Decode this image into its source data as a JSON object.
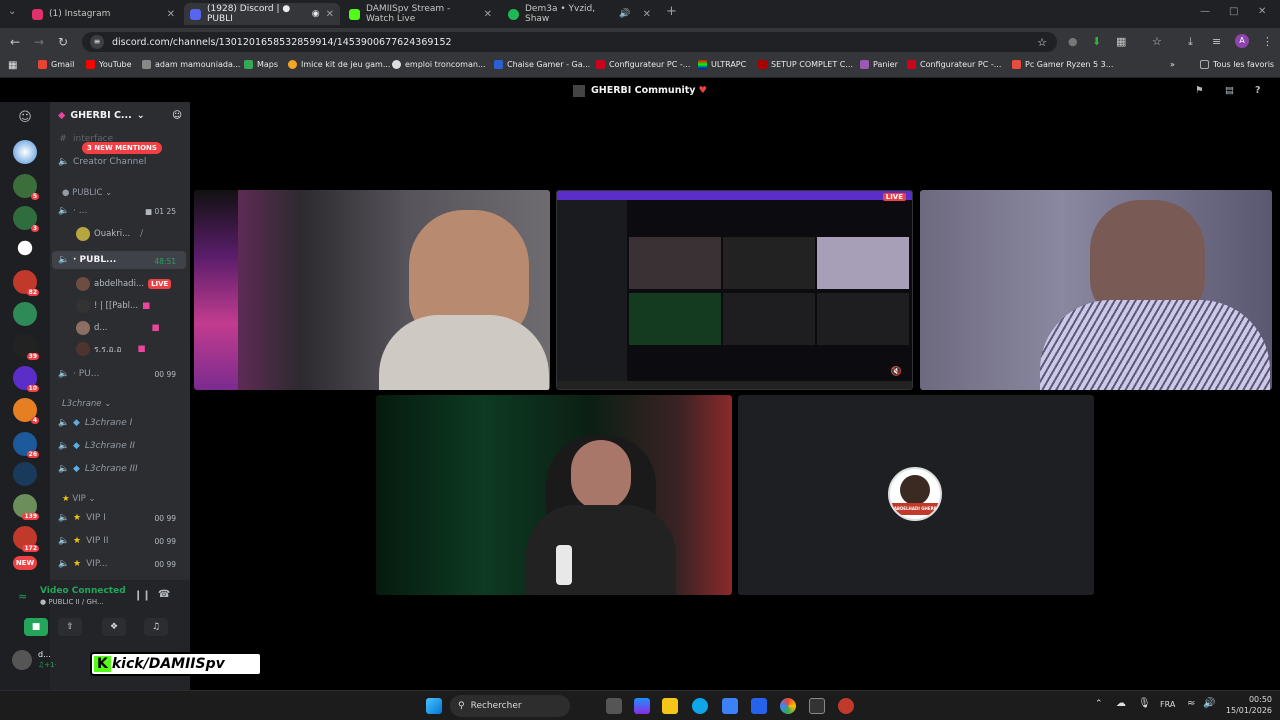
{
  "tabs": [
    {
      "title": "(1) Instagram",
      "color": "#e1306c"
    },
    {
      "title": "(1928) Discord | ● PUBLI",
      "color": "#5865f2"
    },
    {
      "title": "DAMIISpv Stream - Watch Live",
      "color": "#53fc18"
    },
    {
      "title": "Dem3a • Yvzid, Shaw",
      "color": "#1db954"
    }
  ],
  "url": "discord.com/channels/1301201658532859914/1453900677624369152",
  "bookmarks": [
    "Gmail",
    "YouTube",
    "adam mamouniada...",
    "Maps",
    "Imice kit de jeu gam...",
    "emploi troncoman...",
    "Chaise Gamer - Ga...",
    "Configurateur PC -...",
    "ULTRAPC",
    "SETUP COMPLET C...",
    "Panier",
    "Configurateur PC -...",
    "Pc Gamer Ryzen 5 3..."
  ],
  "bookmarks_all": "Tous les favoris",
  "discord_title": "GHERBI Community",
  "server": {
    "name": "GHERBI C...",
    "mentions": "3 NEW MENTIONS"
  },
  "server_badges": [
    "5",
    "3",
    "82",
    "39",
    "10",
    "4",
    "26",
    "139",
    "172",
    "NEW"
  ],
  "channels": {
    "interface": "interface",
    "creator": "Creator Channel",
    "public_cat": "PUBLIC",
    "vc1": {
      "name": "· ...",
      "count_a": "01",
      "count_b": "25"
    },
    "vc1_user": "Ouakri...",
    "vc2": {
      "name": "· PUBL...",
      "time": "48:51"
    },
    "vc2_users": [
      "abdelhadi...",
      "! | [[Pabl...",
      "d...",
      "ร.ร.อ.อ"
    ],
    "live": "LIVE",
    "vc3": {
      "name": "· PU...",
      "a": "00",
      "b": "99"
    },
    "l3_cat": "L3chrane",
    "l3": [
      "L3chrane I",
      "L3chrane II",
      "L3chrane III"
    ],
    "vip_cat": "VIP",
    "vip": [
      {
        "name": "VIP I",
        "a": "00",
        "b": "99"
      },
      {
        "name": "VIP II",
        "a": "00",
        "b": "99"
      },
      {
        "name": "VIP...",
        "a": "00",
        "b": "99"
      }
    ]
  },
  "voice": {
    "status": "Video Connected",
    "channel": "● PUBLIC II / GH..."
  },
  "me": {
    "name": "d...",
    "sub": "♫+1·"
  },
  "overlay": "kick/DAMIISpv",
  "stream": {
    "live": "LIVE"
  },
  "avatar_label": "ABDELHADI GHERBI",
  "taskbar": {
    "search": "Rechercher",
    "lang": "FRA",
    "time": "00:50",
    "date": "15/01/2026"
  }
}
